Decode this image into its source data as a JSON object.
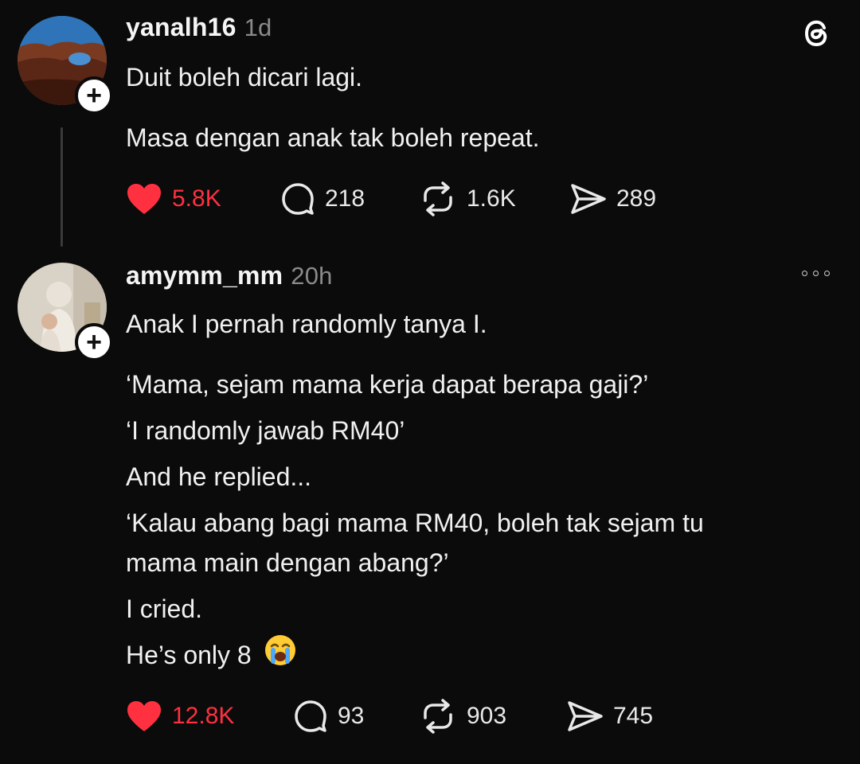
{
  "app": {
    "logo_icon": "threads-logo-icon",
    "accent_like": "#ff3040"
  },
  "posts": [
    {
      "username": "yanalh16",
      "time": "1d",
      "lines": [
        "Duit boleh dicari lagi.",
        "Masa dengan anak tak boleh repeat."
      ],
      "likes": "5.8K",
      "replies": "218",
      "reposts": "1.6K",
      "shares": "289"
    },
    {
      "username": "amymm_mm",
      "time": "20h",
      "lines": [
        "Anak I pernah randomly tanya I.",
        "‘Mama, sejam mama kerja dapat berapa gaji?’",
        "‘I randomly jawab RM40’",
        "And he replied...",
        "‘Kalau abang bagi mama RM40, boleh tak sejam tu",
        "mama main dengan abang?’",
        "I cried.",
        "He’s only 8"
      ],
      "likes": "12.8K",
      "replies": "93",
      "reposts": "903",
      "shares": "745"
    }
  ]
}
